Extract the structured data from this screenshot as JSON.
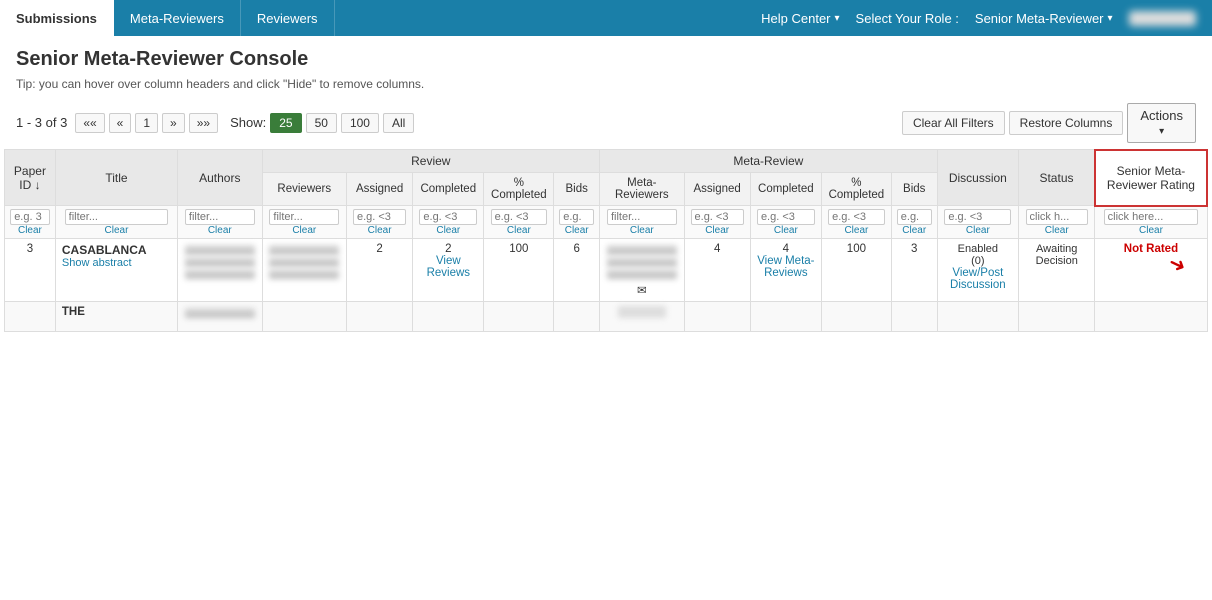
{
  "nav": {
    "tabs": [
      {
        "label": "Submissions",
        "active": true
      },
      {
        "label": "Meta-Reviewers",
        "active": false
      },
      {
        "label": "Reviewers",
        "active": false
      }
    ],
    "help_center": "Help Center",
    "select_role_label": "Select Your Role :",
    "role": "Senior Meta-Reviewer",
    "user": "User Profile"
  },
  "page": {
    "title": "Senior Meta-Reviewer Console",
    "tip": "Tip: you can hover over column headers and click \"Hide\" to remove columns."
  },
  "toolbar": {
    "pagination": "1 - 3 of 3",
    "first_label": "««",
    "prev_label": "«",
    "page1_label": "1",
    "next_label": "»",
    "last_label": "»»",
    "show_label": "Show:",
    "show_options": [
      "25",
      "50",
      "100",
      "All"
    ],
    "active_show": "25",
    "clear_filters_label": "Clear All Filters",
    "restore_cols_label": "Restore Columns",
    "actions_label": "Actions"
  },
  "table": {
    "group_headers": {
      "review": "Review",
      "meta_review": "Meta-Review"
    },
    "columns": {
      "paper_id": "Paper ID ↓",
      "title": "Title",
      "authors": "Authors",
      "reviewers": "Reviewers",
      "assigned": "Assigned",
      "completed": "Completed",
      "pct_completed": "% Completed",
      "bids": "Bids",
      "meta_reviewers": "Meta-Reviewers",
      "assigned2": "Assigned",
      "completed2": "Completed",
      "pct_completed2": "% Completed",
      "bids2": "Bids",
      "discussion": "Discussion",
      "status": "Status",
      "rating": "Senior Meta-Reviewer Rating"
    },
    "filters": {
      "paper_id": "e.g. 3",
      "title": "filter...",
      "authors": "filter...",
      "reviewers": "filter...",
      "assigned": "e.g. <3",
      "completed": "e.g. <3",
      "pct_completed": "e.g. <3",
      "bids": "e.g.",
      "meta_reviewers": "filter...",
      "assigned2": "e.g. <3",
      "completed2": "e.g. <3",
      "pct_completed2": "e.g. <3",
      "bids2": "e.g.",
      "discussion": "e.g. <3",
      "status": "click h...",
      "rating": "click here..."
    },
    "rows": [
      {
        "paper_id": "3",
        "title": "CASABLANCA",
        "show_abstract": "Show abstract",
        "authors": "blurred",
        "reviewers": "blurred",
        "assigned": "2",
        "completed": "2\nView\nReviews",
        "pct_completed": "100",
        "bids": "6",
        "meta_reviewers": "blurred",
        "assigned2": "4",
        "completed2": "4\nView Meta-\nReviews",
        "pct_completed2": "100",
        "bids2": "3",
        "discussion": "Enabled\n(0)\nView/Post\nDiscussion",
        "status": "Awaiting\nDecision",
        "rating": "Not Rated",
        "has_envelope": true
      },
      {
        "paper_id": "",
        "title": "THE",
        "authors": "blurred",
        "show_abstract": "",
        "reviewers": "",
        "assigned": "",
        "completed": "",
        "pct_completed": "",
        "bids": "",
        "meta_reviewers": "blurred_abc",
        "assigned2": "",
        "completed2": "",
        "pct_completed2": "",
        "bids2": "",
        "discussion": "",
        "status": "",
        "rating": ""
      }
    ]
  }
}
